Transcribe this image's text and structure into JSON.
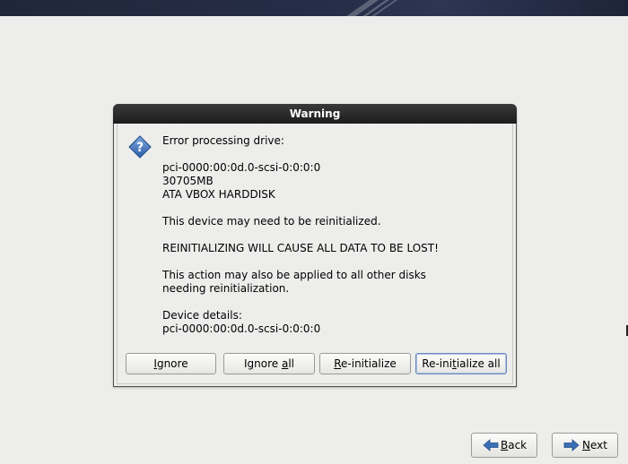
{
  "dialog": {
    "title": "Warning",
    "icon": "question-icon",
    "message": {
      "line1": "Error processing drive:",
      "device_path": "pci-0000:00:0d.0-scsi-0:0:0:0",
      "size": "30705MB",
      "model": "ATA VBOX HARDDISK",
      "line_reinit": "This device may need to be reinitialized.",
      "line_warning": "REINITIALIZING WILL CAUSE ALL DATA TO BE LOST!",
      "line_action_1": "This action may also be applied to all other disks",
      "line_action_2": "needing reinitialization.",
      "details_label": "Device details:",
      "details_value": "pci-0000:00:0d.0-scsi-0:0:0:0"
    },
    "buttons": {
      "ignore": {
        "mnemonic": "I",
        "rest": "gnore"
      },
      "ignore_all": {
        "before": "Ignore ",
        "mnemonic": "a",
        "after": "ll"
      },
      "reinit": {
        "mnemonic": "R",
        "rest": "e-initialize"
      },
      "reinit_all": {
        "before": "Re-ini",
        "mnemonic": "t",
        "after": "ialize all"
      }
    }
  },
  "footer": {
    "back": {
      "mnemonic": "B",
      "rest": "ack"
    },
    "next": {
      "mnemonic": "N",
      "rest": "ext"
    }
  },
  "colors": {
    "background": "#ededec",
    "titlebar": "#1c1c1c",
    "accent_blue": "#3b6fb6",
    "focus_border": "#6c8dbd"
  }
}
